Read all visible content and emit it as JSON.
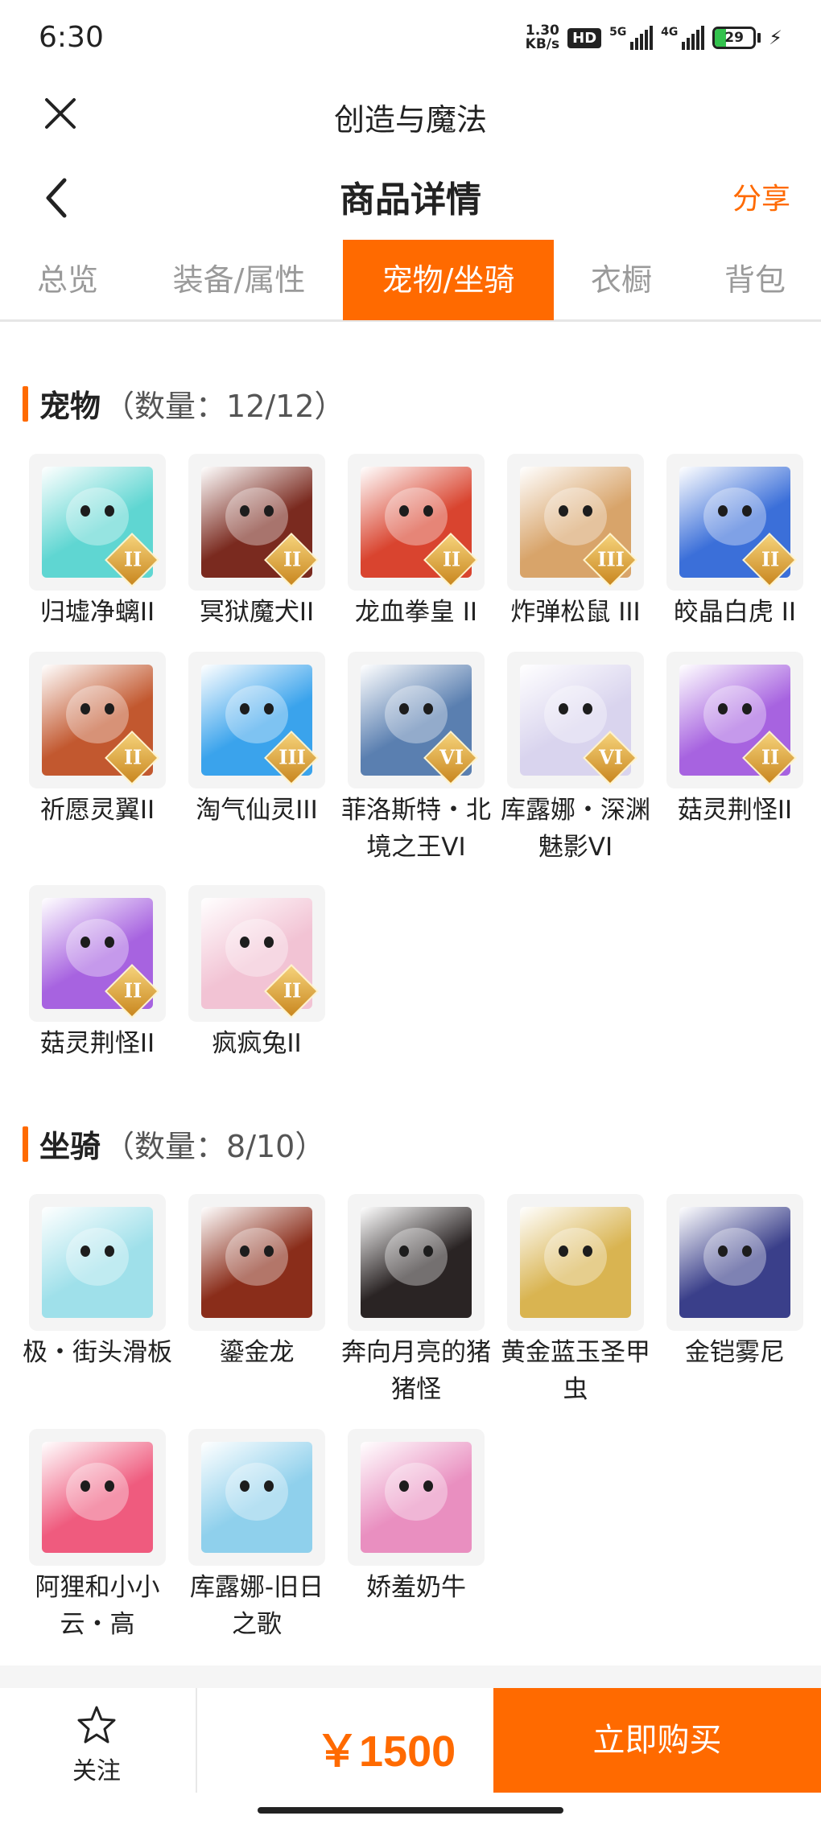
{
  "status_bar": {
    "time": "6:30",
    "net_speed_value": "1.30",
    "net_speed_unit": "KB/s",
    "hd": "HD",
    "net_5g": "5G",
    "net_4g": "4G",
    "battery": "29",
    "battery_level": 0.29
  },
  "app_bar": {
    "title": "创造与魔法"
  },
  "header": {
    "title": "商品详情",
    "share": "分享"
  },
  "tabs": [
    {
      "label": "总览"
    },
    {
      "label": "装备/属性"
    },
    {
      "label": "宠物/坐骑"
    },
    {
      "label": "衣橱"
    },
    {
      "label": "背包"
    }
  ],
  "pets": {
    "title": "宠物",
    "count": "（数量：12/12）",
    "items": [
      {
        "name": "归墟净螭II",
        "rank": "II",
        "color": "#5fd6d2"
      },
      {
        "name": "冥狱魔犬II",
        "rank": "II",
        "color": "#7a2a1f"
      },
      {
        "name": "龙血拳皇 II",
        "rank": "II",
        "color": "#d9442f"
      },
      {
        "name": "炸弹松鼠 III",
        "rank": "III",
        "color": "#d8a46a"
      },
      {
        "name": "皎晶白虎 II",
        "rank": "II",
        "color": "#3b6fd9"
      },
      {
        "name": "祈愿灵翼II",
        "rank": "II",
        "color": "#c2582f"
      },
      {
        "name": "淘气仙灵III",
        "rank": "III",
        "color": "#3aa3ec"
      },
      {
        "name": "菲洛斯特・北境之王VI",
        "rank": "VI",
        "color": "#5a7fb0"
      },
      {
        "name": "库露娜・深渊魅影VI",
        "rank": "VI",
        "color": "#d9d4ee"
      },
      {
        "name": "菇灵荆怪II",
        "rank": "II",
        "color": "#a763e0"
      },
      {
        "name": "菇灵荆怪II",
        "rank": "II",
        "color": "#a763e0"
      },
      {
        "name": "疯疯兔II",
        "rank": "II",
        "color": "#f2c3d4"
      }
    ]
  },
  "mounts": {
    "title": "坐骑",
    "count": "（数量：8/10）",
    "items": [
      {
        "name": "极・街头滑板",
        "color": "#9fe0ea"
      },
      {
        "name": "鎏金龙",
        "color": "#8a2d1a"
      },
      {
        "name": "奔向月亮的猪猪怪",
        "color": "#2a2424"
      },
      {
        "name": "黄金蓝玉圣甲虫",
        "color": "#d9b451"
      },
      {
        "name": "金铠雾尼",
        "color": "#3a3f8a"
      },
      {
        "name": "阿狸和小小云・高",
        "color": "#ef5b7e"
      },
      {
        "name": "库露娜-旧日之歌",
        "color": "#8fd0ec"
      },
      {
        "name": "娇羞奶牛",
        "color": "#e98fc0"
      }
    ]
  },
  "bottom": {
    "follow": "关注",
    "price": "￥1500",
    "buy": "立即购买"
  }
}
